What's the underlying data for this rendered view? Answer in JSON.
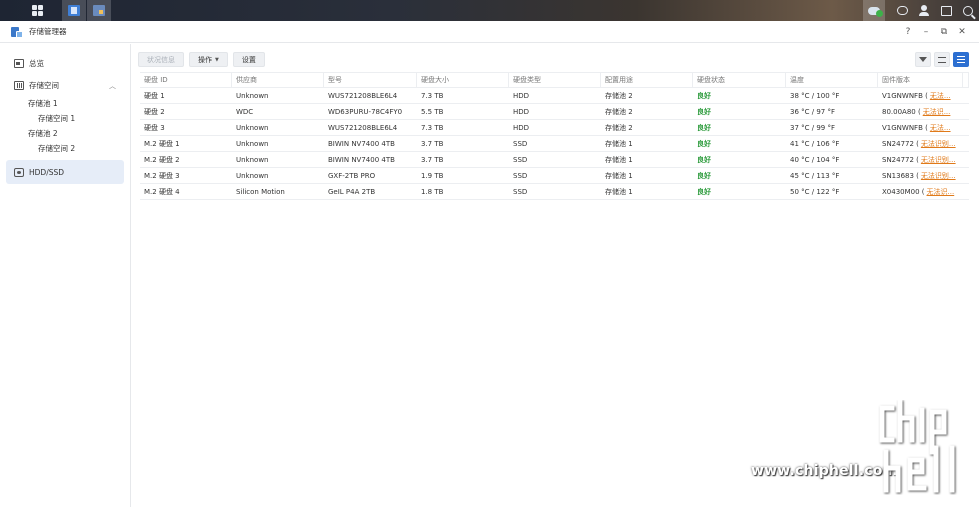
{
  "window": {
    "title": "存储管理器"
  },
  "window_controls": {
    "help": "?",
    "minimize": "–",
    "restore": "⧉",
    "close": "✕"
  },
  "sidebar": {
    "items": [
      {
        "label": "总览"
      },
      {
        "label": "存储空间"
      },
      {
        "label": "存储池 1"
      },
      {
        "label": "存储空间 1"
      },
      {
        "label": "存储池 2"
      },
      {
        "label": "存储空间 2"
      },
      {
        "label": "HDD/SSD"
      }
    ]
  },
  "toolbar": {
    "info": "状况信息",
    "action": "操作",
    "settings": "设置"
  },
  "table": {
    "headers": [
      "硬盘 ID",
      "供应商",
      "型号",
      "硬盘大小",
      "硬盘类型",
      "配置用途",
      "硬盘状态",
      "温度",
      "固件版本"
    ],
    "rows": [
      {
        "id": "硬盘 1",
        "vendor": "Unknown",
        "model": "WUS721208BLE6L4",
        "size": "7.3 TB",
        "type": "HDD",
        "usage": "存储池 2",
        "status": "良好",
        "temp": "38 °C / 100 °F",
        "fw": "V1GNWNFB (",
        "fw_link": "无法..."
      },
      {
        "id": "硬盘 2",
        "vendor": "WDC",
        "model": "WD63PURU-78C4FY0",
        "size": "5.5 TB",
        "type": "HDD",
        "usage": "存储池 2",
        "status": "良好",
        "temp": "36 °C / 97 °F",
        "fw": "80.00A80 (",
        "fw_link": "无法识..."
      },
      {
        "id": "硬盘 3",
        "vendor": "Unknown",
        "model": "WUS721208BLE6L4",
        "size": "7.3 TB",
        "type": "HDD",
        "usage": "存储池 2",
        "status": "良好",
        "temp": "37 °C / 99 °F",
        "fw": "V1GNWNFB (",
        "fw_link": "无法..."
      },
      {
        "id": "M.2 硬盘 1",
        "vendor": "Unknown",
        "model": "BIWIN NV7400 4TB",
        "size": "3.7 TB",
        "type": "SSD",
        "usage": "存储池 1",
        "status": "良好",
        "temp": "41 °C / 106 °F",
        "fw": "SN24772 (",
        "fw_link": "无法识别..."
      },
      {
        "id": "M.2 硬盘 2",
        "vendor": "Unknown",
        "model": "BIWIN NV7400 4TB",
        "size": "3.7 TB",
        "type": "SSD",
        "usage": "存储池 1",
        "status": "良好",
        "temp": "40 °C / 104 °F",
        "fw": "SN24772 (",
        "fw_link": "无法识别..."
      },
      {
        "id": "M.2 硬盘 3",
        "vendor": "Unknown",
        "model": "GXF-2TB PRO",
        "size": "1.9 TB",
        "type": "SSD",
        "usage": "存储池 1",
        "status": "良好",
        "temp": "45 °C / 113 °F",
        "fw": "SN13683 (",
        "fw_link": "无法识别..."
      },
      {
        "id": "M.2 硬盘 4",
        "vendor": "Silicon Motion",
        "model": "GeIL P4A 2TB",
        "size": "1.8 TB",
        "type": "SSD",
        "usage": "存储池 1",
        "status": "良好",
        "temp": "50 °C / 122 °F",
        "fw": "X0430M00 (",
        "fw_link": "无法识..."
      }
    ]
  },
  "colors": {
    "good": "#2a9a3a",
    "link": "#e07a1a",
    "accent": "#2c6fd1"
  },
  "watermark": {
    "url": "www.chiphell.com",
    "logo_text": "chip hell"
  }
}
